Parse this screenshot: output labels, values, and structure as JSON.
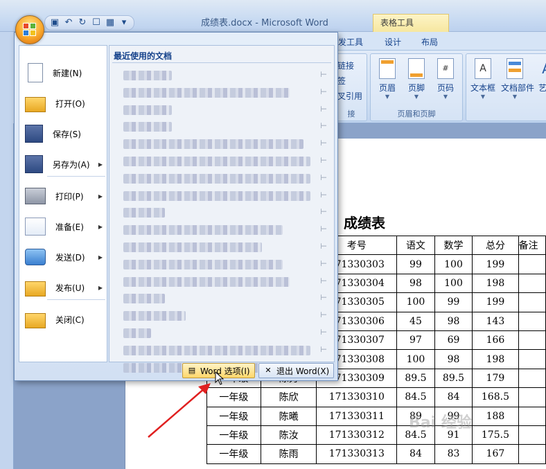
{
  "window": {
    "title": "成绩表.docx - Microsoft Word",
    "context_group": "表格工具"
  },
  "ribbon": {
    "tabs": [
      "发工具",
      "设计",
      "布局"
    ],
    "insert_links_partial": [
      "链接",
      "签",
      "叉引用"
    ],
    "partial_group_label": "接",
    "header_footer": {
      "buttons": [
        "页眉",
        "页脚",
        "页码"
      ],
      "group_label": "页眉和页脚"
    },
    "text_group": {
      "buttons": [
        "文本框",
        "文档部件",
        "艺术"
      ]
    }
  },
  "office_menu": {
    "items": [
      {
        "label": "新建(N)",
        "submenu": false
      },
      {
        "label": "打开(O)",
        "submenu": false
      },
      {
        "label": "保存(S)",
        "submenu": false
      },
      {
        "label": "另存为(A)",
        "submenu": true
      },
      {
        "label": "打印(P)",
        "submenu": true
      },
      {
        "label": "准备(E)",
        "submenu": true
      },
      {
        "label": "发送(D)",
        "submenu": true
      },
      {
        "label": "发布(U)",
        "submenu": true
      },
      {
        "label": "关闭(C)",
        "submenu": false
      }
    ],
    "recent_title": "最近使用的文档",
    "word_options": "Word 选项(I)",
    "exit_word": "退出 Word(X)"
  },
  "document": {
    "title": "成绩表",
    "table": {
      "headers": [
        "",
        "",
        "考号",
        "语文",
        "数学",
        "总分",
        "备注"
      ],
      "rows": [
        [
          "",
          "",
          "171330303",
          "99",
          "100",
          "199",
          ""
        ],
        [
          "",
          "",
          "171330304",
          "98",
          "100",
          "198",
          ""
        ],
        [
          "",
          "",
          "171330305",
          "100",
          "99",
          "199",
          ""
        ],
        [
          "",
          "",
          "171330306",
          "45",
          "98",
          "143",
          ""
        ],
        [
          "",
          "",
          "171330307",
          "97",
          "69",
          "166",
          ""
        ],
        [
          "",
          "",
          "171330308",
          "100",
          "98",
          "198",
          ""
        ],
        [
          "一年级",
          "陈秀",
          "171330309",
          "89.5",
          "89.5",
          "179",
          ""
        ],
        [
          "一年级",
          "陈欣",
          "171330310",
          "84.5",
          "84",
          "168.5",
          ""
        ],
        [
          "一年级",
          "陈曦",
          "171330311",
          "89",
          "99",
          "188",
          ""
        ],
        [
          "一年级",
          "陈汝",
          "171330312",
          "84.5",
          "91",
          "175.5",
          ""
        ],
        [
          "一年级",
          "陈雨",
          "171330313",
          "84",
          "83",
          "167",
          ""
        ]
      ]
    }
  },
  "watermark": "Bai 经验",
  "colors": {
    "ribbon_blue": "#15428b",
    "highlight": "#ffd76a",
    "arrow": "#e02020"
  }
}
